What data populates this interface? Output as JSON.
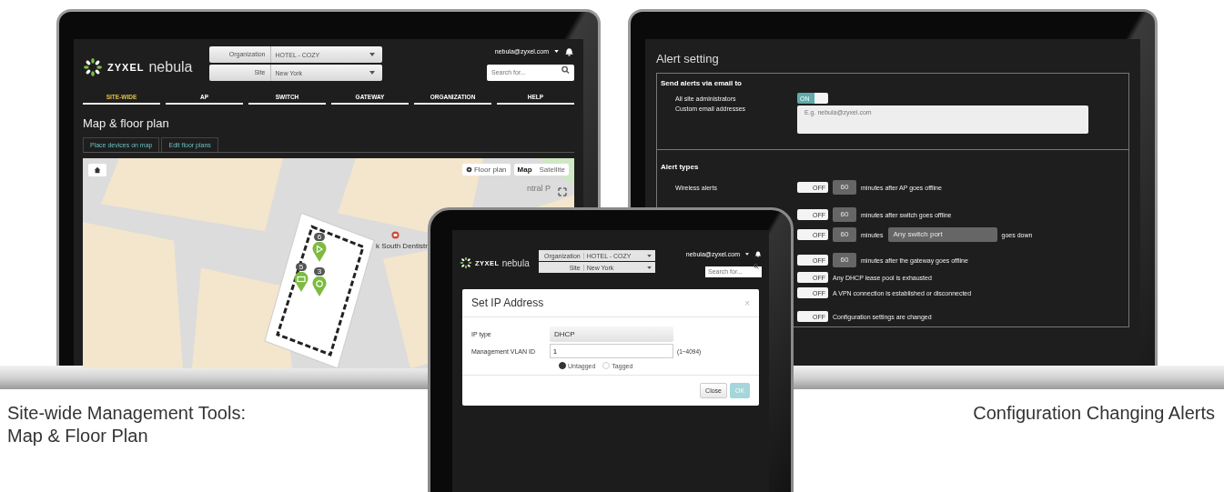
{
  "left_laptop": {
    "header": {
      "brand": "ZYXEL",
      "product": "nebula",
      "selectors": [
        {
          "label": "Organization",
          "value": "HOTEL - COZY"
        },
        {
          "label": "Site",
          "value": "New York"
        }
      ],
      "user": "nebula@zyxel.com",
      "search": {
        "placeholder": "Search for..."
      }
    },
    "nav": [
      {
        "label": "SITE-WIDE",
        "selected": true
      },
      {
        "label": "AP",
        "selected": false
      },
      {
        "label": "SWITCH",
        "selected": false
      },
      {
        "label": "GATEWAY",
        "selected": false
      },
      {
        "label": "ORGANIZATION",
        "selected": false
      },
      {
        "label": "HELP",
        "selected": false
      }
    ],
    "page_title": "Map & floor plan",
    "tabs": [
      "Place devices on map",
      "Edit floor plans"
    ],
    "map": {
      "floor_plan_button": "Floor plan",
      "map_types": [
        {
          "label": "Map",
          "selected": true
        },
        {
          "label": "Satellite",
          "selected": false
        }
      ],
      "place_label": "k South Dentistr",
      "street_label": "ntral P",
      "markers": [
        {
          "count": "6",
          "kind": "triangle"
        },
        {
          "count": "5",
          "kind": "square"
        },
        {
          "count": "3",
          "kind": "circle"
        }
      ]
    }
  },
  "right_laptop": {
    "title": "Alert setting",
    "email_section": {
      "heading": "Send alerts via email to",
      "admins": {
        "label": "All site administrators",
        "on": true,
        "toggle_text": "ON"
      },
      "custom": {
        "label": "Custom email addresses",
        "placeholder": "E.g. nebula@zyxel.com"
      }
    },
    "types_section": {
      "heading": "Alert types",
      "rows": [
        {
          "kind": "minutes",
          "label": "Wireless alerts",
          "on": false,
          "toggle_text": "OFF",
          "minutes": "60",
          "text": "minutes after AP goes offline"
        },
        {
          "kind": "minutes",
          "on": false,
          "toggle_text": "OFF",
          "minutes": "60",
          "text": "minutes after switch goes offline"
        },
        {
          "kind": "port",
          "on": false,
          "toggle_text": "OFF",
          "minutes": "60",
          "text": "minutes",
          "port": "Any switch port",
          "suffix": "goes down"
        },
        {
          "kind": "minutes",
          "on": false,
          "toggle_text": "OFF",
          "minutes": "60",
          "text": "minutes after the gateway goes offline"
        },
        {
          "kind": "plain",
          "on": false,
          "toggle_text": "OFF",
          "text": "Any DHCP lease pool is exhausted"
        },
        {
          "kind": "plain",
          "on": false,
          "toggle_text": "OFF",
          "text": "A VPN connection is established or disconnected"
        },
        {
          "kind": "plain",
          "on": false,
          "toggle_text": "OFF",
          "text": "Configuration settings are changed"
        }
      ]
    }
  },
  "tablet": {
    "header": {
      "brand": "ZYXEL",
      "product": "nebula",
      "selectors": [
        {
          "label": "Organization",
          "value": "HOTEL - COZY"
        },
        {
          "label": "Site",
          "value": "New York"
        }
      ],
      "user": "nebula@zyxel.com",
      "search": {
        "placeholder": "Search for..."
      }
    },
    "dialog": {
      "title": "Set IP Address",
      "close": "×",
      "ip_type": {
        "label": "IP type",
        "value": "DHCP"
      },
      "vlan": {
        "label": "Management VLAN ID",
        "value": "1",
        "range": "(1~4094)"
      },
      "radios": [
        {
          "label": "Untagged",
          "selected": true
        },
        {
          "label": "Tagged",
          "selected": false
        }
      ],
      "buttons": [
        {
          "label": "Close",
          "disabled": false
        },
        {
          "label": "OK",
          "disabled": true
        }
      ]
    }
  },
  "captions": {
    "left": [
      "Site-wide Management Tools:",
      "Map & Floor Plan"
    ],
    "right": "Configuration Changing Alerts"
  }
}
